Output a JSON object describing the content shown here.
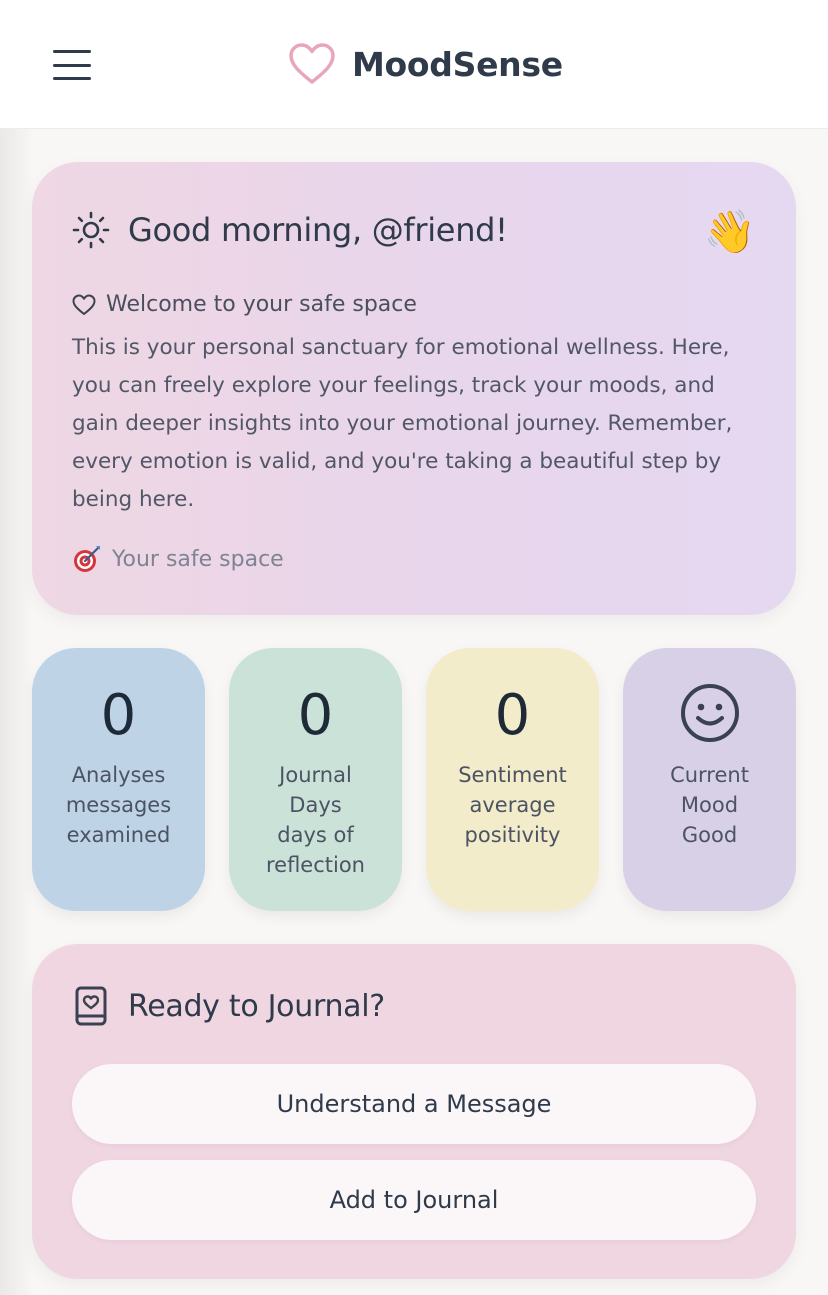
{
  "header": {
    "menu_icon": "hamburger-menu-icon",
    "brand_icon": "heart-outline-icon",
    "brand_name": "MoodSense",
    "brand_color": "#e9a6b8"
  },
  "welcome": {
    "icon": "sun-icon",
    "greeting": "Good morning, @friend!",
    "wave_icon": "👋",
    "safe_space_icon": "heart-outline-icon",
    "safe_space_title": "Welcome to your safe space",
    "body": "This is your personal sanctuary for emotional wellness. Here, you can freely explore your feelings, track your moods, and gain deeper insights into your emotional journey. Remember, every emotion is valid, and you're taking a beautiful step by being here.",
    "footer_icon": "target-icon",
    "footer_text": "Your safe space"
  },
  "stats": [
    {
      "value": "0",
      "label": "Analyses",
      "sub": "messages examined",
      "color": "#bed3e6"
    },
    {
      "value": "0",
      "label": "Journal Days",
      "sub": "days of reflection",
      "color": "#cbe2d8"
    },
    {
      "value": "0",
      "label": "Sentiment",
      "sub": "average positivity",
      "color": "#f3ecca"
    },
    {
      "icon": "smile-face-icon",
      "label": "Current Mood",
      "sub": "Good",
      "color": "#d8d0e6"
    }
  ],
  "journal": {
    "icon": "journal-book-icon",
    "title": "Ready to Journal?",
    "buttons": [
      "Understand a Message",
      "Add to Journal"
    ]
  }
}
